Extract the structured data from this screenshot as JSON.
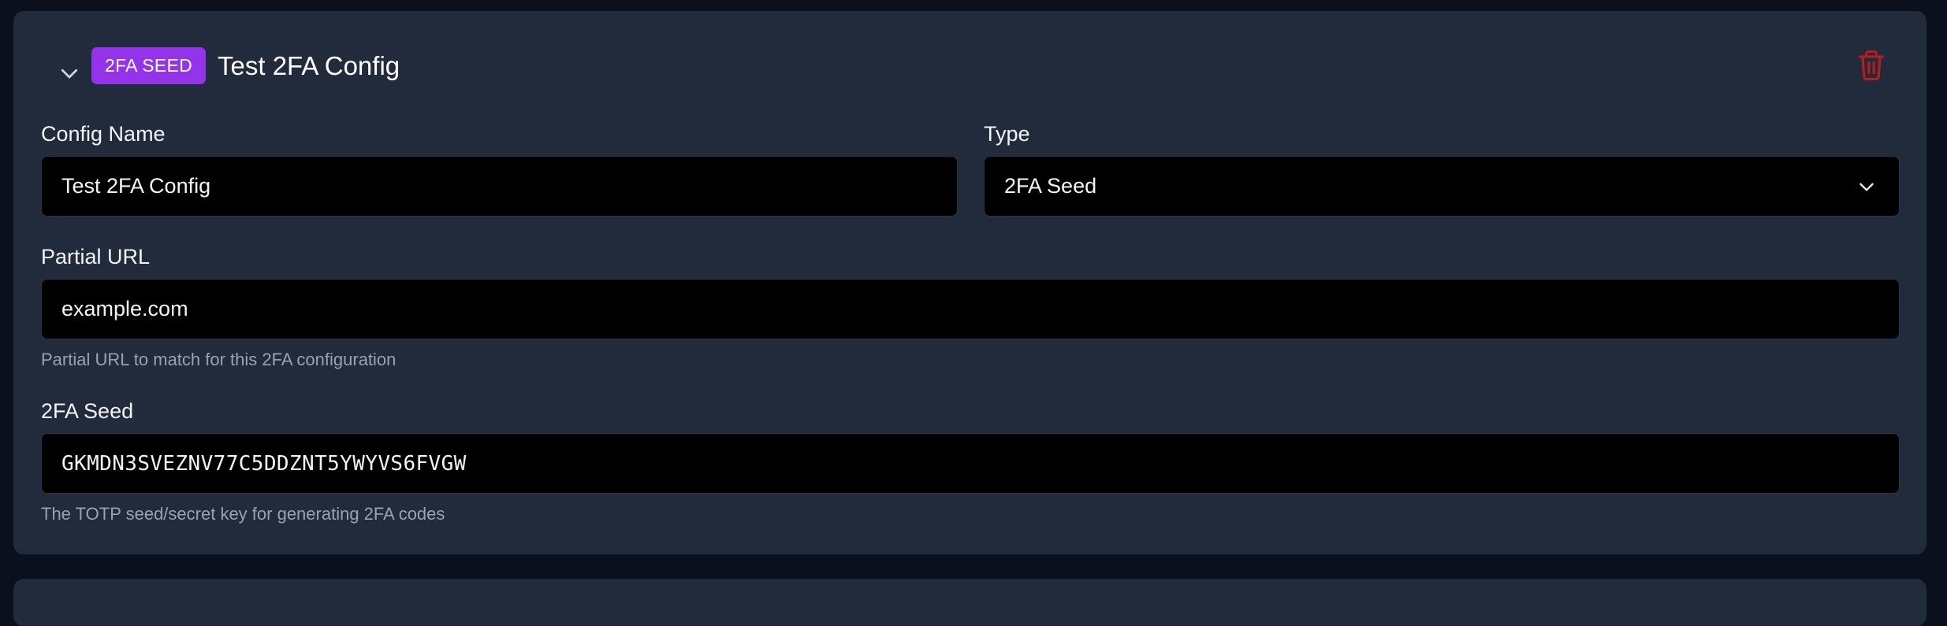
{
  "config": {
    "badge": "2FA SEED",
    "title": "Test 2FA Config",
    "fields": {
      "config_name": {
        "label": "Config Name",
        "value": "Test 2FA Config"
      },
      "type": {
        "label": "Type",
        "value": "2FA Seed"
      },
      "partial_url": {
        "label": "Partial URL",
        "value": "example.com",
        "helper": "Partial URL to match for this 2FA configuration"
      },
      "seed": {
        "label": "2FA Seed",
        "value": "GKMDN3SVEZNV77C5DDZNT5YWYVS6FVGW",
        "helper": "The TOTP seed/secret key for generating 2FA codes"
      }
    }
  },
  "icons": {
    "collapse": "chevron-down-icon",
    "delete": "trash-icon",
    "select": "chevron-down-icon"
  },
  "colors": {
    "page_bg": "#0a101d",
    "card_bg": "#222b3c",
    "badge_bg": "#9333ea",
    "input_bg": "#000000",
    "trash": "#b91c1c",
    "helper_text": "#98a2b3"
  }
}
